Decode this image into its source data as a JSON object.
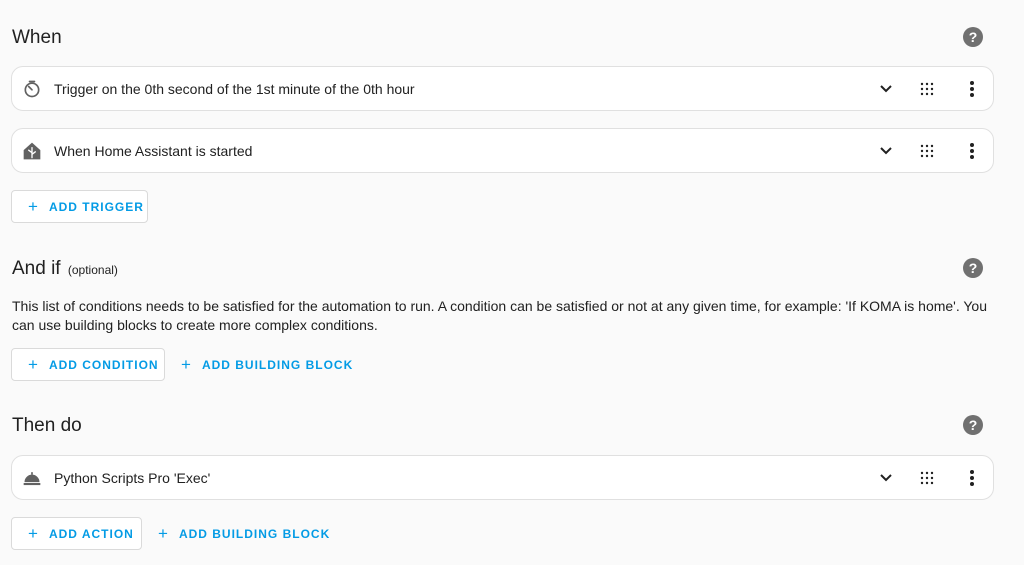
{
  "triggers": {
    "title": "When",
    "items": [
      {
        "label": "Trigger on the 0th second of the 1st minute of the 0th hour",
        "icon": "timer-icon"
      },
      {
        "label": "When Home Assistant is started",
        "icon": "home-assistant-icon"
      }
    ],
    "add_trigger_label": "ADD TRIGGER"
  },
  "conditions": {
    "title": "And if",
    "optional_label": "(optional)",
    "description": "This list of conditions needs to be satisfied for the automation to run. A condition can be satisfied or not at any given time, for example: 'If KOMA is home'. You can use building blocks to create more complex conditions.",
    "add_condition_label": "ADD CONDITION",
    "add_building_block_label": "ADD BUILDING BLOCK"
  },
  "actions": {
    "title": "Then do",
    "items": [
      {
        "label": "Python Scripts Pro 'Exec'",
        "icon": "service-bell-icon"
      }
    ],
    "add_action_label": "ADD ACTION",
    "add_building_block_label": "ADD BUILDING BLOCK"
  },
  "help_icon_glyph": "?",
  "plus_glyph": "+",
  "accent_color": "#039be5"
}
